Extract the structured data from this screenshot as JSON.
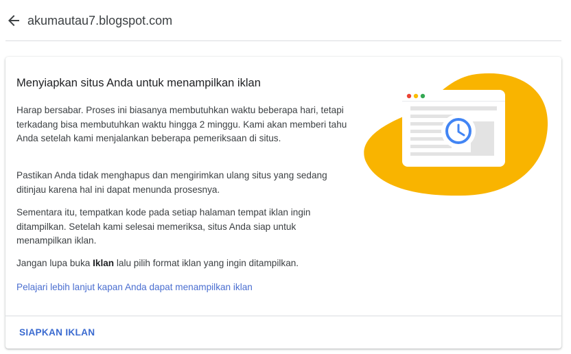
{
  "header": {
    "back_icon": "arrow-left-icon",
    "site_name": "akumautau7.blogspot.com"
  },
  "card": {
    "title": "Menyiapkan situs Anda untuk menampilkan iklan",
    "paragraph1": "Harap bersabar. Proses ini biasanya membutuhkan waktu beberapa hari, tetapi terkadang bisa membutuhkan waktu hingga 2 minggu. Kami akan memberi tahu Anda setelah kami menjalankan beberapa pemeriksaan di situs.",
    "paragraph2": "Pastikan Anda tidak menghapus dan mengirimkan ulang situs yang sedang ditinjau karena hal ini dapat menunda prosesnya.",
    "paragraph3": "Sementara itu, tempatkan kode pada setiap halaman tempat iklan ingin ditampilkan. Setelah kami selesai memeriksa, situs Anda siap untuk menampilkan iklan.",
    "paragraph4_before": "Jangan lupa buka ",
    "paragraph4_bold": "Iklan",
    "paragraph4_after": " lalu pilih format iklan yang ingin ditampilkan.",
    "learn_more_link": "Pelajari lebih lanjut kapan Anda dapat menampilkan iklan",
    "action_button": "SIAPKAN IKLAN",
    "illustration_icon": "browser-window-clock-icon"
  },
  "colors": {
    "accent_blue": "#4285f4",
    "link_blue": "#4a6ed0",
    "blob_yellow": "#f9b400",
    "dot_red": "#ea4335",
    "dot_yellow": "#fbbc04",
    "dot_green": "#34a853"
  }
}
